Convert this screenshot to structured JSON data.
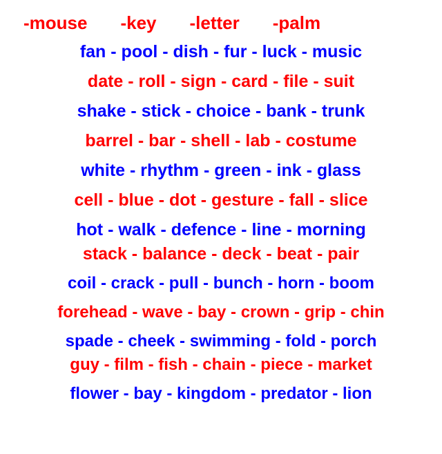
{
  "header": {
    "items": [
      "-mouse",
      "-key",
      "-letter",
      "-palm"
    ]
  },
  "lines": [
    {
      "text": "fan - pool - dish - fur - luck - music",
      "color": "blue"
    },
    {
      "text": "date - roll - sign - card - file - suit",
      "color": "red"
    },
    {
      "text": "shake - stick - choice - bank - trunk",
      "color": "blue"
    },
    {
      "text": "barrel - bar - shell - lab - costume",
      "color": "red"
    },
    {
      "text": "white - rhythm - green - ink - glass",
      "color": "blue"
    },
    {
      "text": "cell - blue - dot - gesture - fall - slice",
      "color": "red"
    },
    {
      "text": "hot - walk - defence - line - morning",
      "color": "blue"
    },
    {
      "text": "stack - balance - deck - beat - pair",
      "color": "red"
    },
    {
      "text": "coil - crack - pull - bunch - horn - boom",
      "color": "blue"
    },
    {
      "text": "forehead - wave - bay - crown - grip - chin",
      "color": "red"
    },
    {
      "text": "spade - cheek - swimming - fold - porch",
      "color": "blue"
    },
    {
      "text": "guy - film - fish - chain - piece - market",
      "color": "red"
    },
    {
      "text": "flower - bay - kingdom - predator - lion",
      "color": "blue"
    }
  ]
}
